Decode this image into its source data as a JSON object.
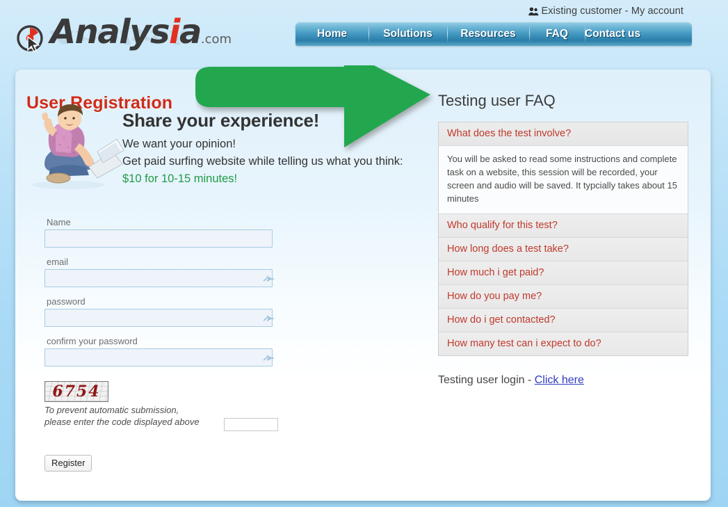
{
  "header": {
    "account_link": "Existing customer - My account",
    "account_icon": "users-icon",
    "logo": {
      "text_a": "Analys",
      "text_i": "i",
      "text_b": "a",
      "suffix": ".com",
      "mark_icon": "magnifier-cursor-icon"
    },
    "nav": [
      {
        "label": "Home"
      },
      {
        "label": "Solutions"
      },
      {
        "label": "Resources"
      },
      {
        "label": "FAQ"
      },
      {
        "label": "Contact us"
      }
    ]
  },
  "main": {
    "page_title": "User Registration",
    "hero": {
      "heading": "Share your experience!",
      "line1": "We want your opinion!",
      "line2": "Get paid surfing website while telling us what you think:",
      "price": "$10 for 10-15 minutes!",
      "image_alt": "person-with-laptop-thumbs-up"
    },
    "form": {
      "fields": [
        {
          "label": "Name",
          "value": "",
          "placeholder": "",
          "type": "text",
          "icon": null
        },
        {
          "label": "email",
          "value": "",
          "placeholder": "",
          "type": "text",
          "icon": "key-icon"
        },
        {
          "label": "password",
          "value": "",
          "placeholder": "",
          "type": "password",
          "icon": "key-icon"
        },
        {
          "label": "confirm your password",
          "value": "",
          "placeholder": "",
          "type": "password",
          "icon": "key-icon"
        }
      ],
      "captcha": {
        "code": "6754",
        "note_line1": "To prevent automatic submission,",
        "note_line2": "please enter the code displayed above",
        "input_value": "",
        "input_placeholder": ""
      },
      "submit_label": "Register"
    }
  },
  "faq": {
    "title": "Testing user FAQ",
    "items": [
      {
        "question": "What does the test involve?",
        "answer": "You will be asked to read some instructions and complete task on a website, this session will be recorded, your screen and audio will be saved. It typcially takes about 15 minutes",
        "open": true
      },
      {
        "question": "Who qualify for this test?",
        "answer": "",
        "open": false
      },
      {
        "question": "How long does a test take?",
        "answer": "",
        "open": false
      },
      {
        "question": "How much i get paid?",
        "answer": "",
        "open": false
      },
      {
        "question": "How do you pay me?",
        "answer": "",
        "open": false
      },
      {
        "question": "How do i get contacted?",
        "answer": "",
        "open": false
      },
      {
        "question": "How many test can i expect to do?",
        "answer": "",
        "open": false
      }
    ],
    "login_text": "Testing user login - ",
    "login_link": "Click here"
  },
  "annotation": {
    "arrow_icon": "green-right-arrow-icon",
    "arrow_color": "#22a74f"
  },
  "colors": {
    "title_red": "#cf2c18",
    "faq_red": "#c0392b",
    "price_green": "#1f9b46",
    "link_blue": "#2f3bbf",
    "nav_blue": "#2b7ea8"
  }
}
